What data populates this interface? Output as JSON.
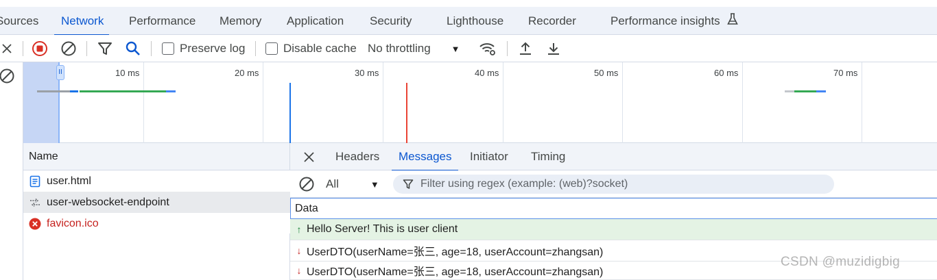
{
  "tabs": [
    "Sources",
    "Network",
    "Performance",
    "Memory",
    "Application",
    "Security",
    "Lighthouse",
    "Recorder",
    "Performance insights"
  ],
  "toolbar": {
    "preserve_log": "Preserve log",
    "disable_cache": "Disable cache",
    "throttling": "No throttling"
  },
  "timeline": {
    "ticks": [
      "10 ms",
      "20 ms",
      "30 ms",
      "40 ms",
      "50 ms",
      "60 ms",
      "70 ms"
    ],
    "pause_glyph": "II"
  },
  "list": {
    "header": "Name",
    "requests": [
      {
        "name": "user.html",
        "type": "document",
        "status": "ok"
      },
      {
        "name": "user-websocket-endpoint",
        "type": "websocket",
        "status": "selected"
      },
      {
        "name": "favicon.ico",
        "type": "error",
        "status": "error"
      }
    ]
  },
  "details": {
    "tabs": [
      "Headers",
      "Messages",
      "Initiator",
      "Timing"
    ],
    "active_tab": "Messages",
    "filter_type": "All",
    "filter_placeholder": "Filter using regex (example: (web)?socket)",
    "data_header": "Data",
    "messages": [
      {
        "direction": "send",
        "arrow": "↑",
        "text": "Hello Server! This is user client"
      },
      {
        "direction": "receive",
        "arrow": "↓",
        "text": "UserDTO(userName=张三, age=18, userAccount=zhangsan)"
      },
      {
        "direction": "receive",
        "arrow": "↓",
        "text": "UserDTO(userName=张三, age=18, userAccount=zhangsan)"
      }
    ]
  },
  "watermark": "CSDN @muzidigbig",
  "colors": {
    "accent": "#0b57d0",
    "record_red": "#d93025",
    "send_bg": "#e4f3e4",
    "error_red": "#c5221f"
  }
}
